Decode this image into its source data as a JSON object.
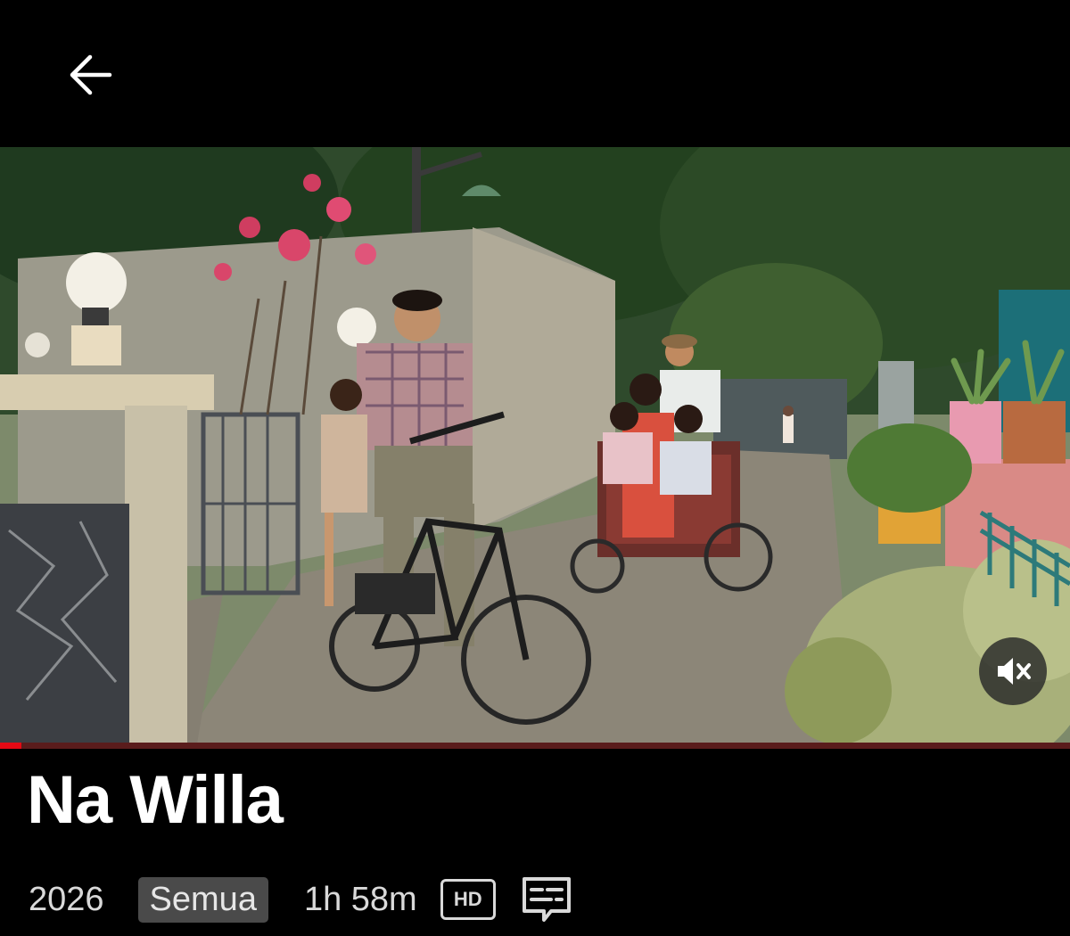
{
  "header": {
    "back_icon": "arrow-left-icon"
  },
  "player": {
    "mute_icon": "volume-muted-icon",
    "progress": 0.02,
    "accent_color": "#e50914"
  },
  "title": "Na Willa",
  "meta": {
    "year": "2026",
    "rating": "Semua",
    "duration": "1h 58m",
    "quality": "HD",
    "subtitles_icon": "subtitles-icon"
  }
}
